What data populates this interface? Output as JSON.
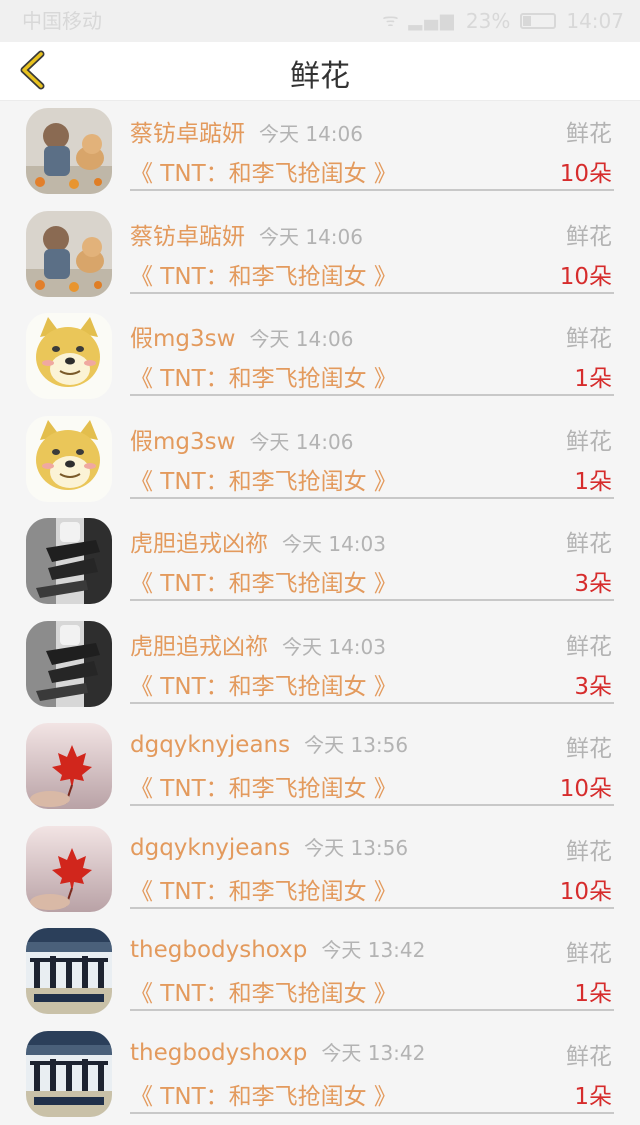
{
  "status_bar": {
    "carrier": "中国移动",
    "battery": "23%",
    "time": "14:07"
  },
  "header": {
    "title": "鲜花"
  },
  "colors": {
    "name": "#e39a5d",
    "count": "#d62c2c",
    "muted": "#b3b3b3",
    "back_arrow": "#e8c21f"
  },
  "records": [
    {
      "name": "蔡钫卓踮妍",
      "time": "今天 14:06",
      "gift": "鲜花",
      "show": "《 TNT：和李飞抢闺女 》",
      "count": "10朵",
      "avatar": "child-dog-photo"
    },
    {
      "name": "蔡钫卓踮妍",
      "time": "今天 14:06",
      "gift": "鲜花",
      "show": "《 TNT：和李飞抢闺女 》",
      "count": "10朵",
      "avatar": "child-dog-photo"
    },
    {
      "name": "假mg3sw",
      "time": "今天 14:06",
      "gift": "鲜花",
      "show": "《 TNT：和李飞抢闺女 》",
      "count": "1朵",
      "avatar": "doge-cartoon"
    },
    {
      "name": "假mg3sw",
      "time": "今天 14:06",
      "gift": "鲜花",
      "show": "《 TNT：和李飞抢闺女 》",
      "count": "1朵",
      "avatar": "doge-cartoon"
    },
    {
      "name": "虎胆追戎凶祢",
      "time": "今天 14:03",
      "gift": "鲜花",
      "show": "《 TNT：和李飞抢闺女 》",
      "count": "3朵",
      "avatar": "bw-legs-photo"
    },
    {
      "name": "虎胆追戎凶祢",
      "time": "今天 14:03",
      "gift": "鲜花",
      "show": "《 TNT：和李飞抢闺女 》",
      "count": "3朵",
      "avatar": "bw-legs-photo"
    },
    {
      "name": "dgqyknyjeans",
      "time": "今天 13:56",
      "gift": "鲜花",
      "show": "《 TNT：和李飞抢闺女 》",
      "count": "10朵",
      "avatar": "maple-leaf-photo"
    },
    {
      "name": "dgqyknyjeans",
      "time": "今天 13:56",
      "gift": "鲜花",
      "show": "《 TNT：和李飞抢闺女 》",
      "count": "10朵",
      "avatar": "maple-leaf-photo"
    },
    {
      "name": "thegbodyshoxp",
      "time": "今天 13:42",
      "gift": "鲜花",
      "show": "《 TNT：和李飞抢闺女 》",
      "count": "1朵",
      "avatar": "beach-group-photo"
    },
    {
      "name": "thegbodyshoxp",
      "time": "今天 13:42",
      "gift": "鲜花",
      "show": "《 TNT：和李飞抢闺女 》",
      "count": "1朵",
      "avatar": "beach-group-photo"
    }
  ]
}
